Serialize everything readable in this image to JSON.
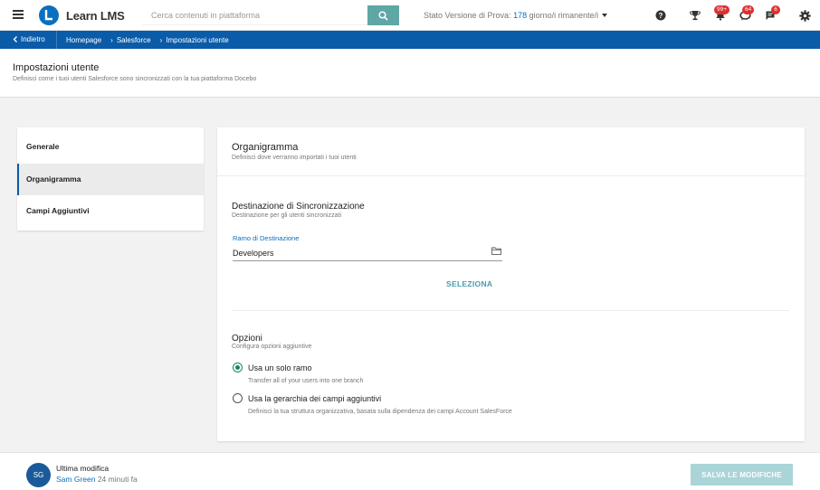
{
  "topbar": {
    "brand": "Learn LMS",
    "search_placeholder": "Cerca contenuti in piattaforma",
    "trial_prefix": "Stato Versione di Prova: ",
    "trial_days": "178",
    "trial_suffix": " giorno/i rimanente/i",
    "badges": {
      "notifications": "99+",
      "messages": "64",
      "tasks": "6"
    },
    "accent_color": "#0a5ba8"
  },
  "breadcrumb": {
    "back_label": "Indietro",
    "items": [
      "Homepage",
      "Salesforce",
      "Impostazioni utente"
    ]
  },
  "page_header": {
    "title": "Impostazioni utente",
    "subtitle": "Definisci come i tuoi utenti Salesforce sono sincronizzati con la tua piattaforma Docebo"
  },
  "sidebar": {
    "items": [
      {
        "label": "Generale",
        "active": false
      },
      {
        "label": "Organigramma",
        "active": true
      },
      {
        "label": "Campi Aggiuntivi",
        "active": false
      }
    ]
  },
  "panel": {
    "title": "Organigramma",
    "subtitle": "Definisci dove verranno importati i tuoi utenti",
    "destination": {
      "title": "Destinazione di Sincronizzazione",
      "subtitle": "Destinazione per gli utenti sincronizzati",
      "field_label": "Ramo di Destinazione",
      "field_value": "Developers",
      "select_label": "SELEZIONA"
    },
    "options": {
      "title": "Opzioni",
      "subtitle": "Configura opzioni aggiuntive",
      "radios": [
        {
          "label": "Usa un solo ramo",
          "description": "Transfer all of your users into one branch",
          "checked": true
        },
        {
          "label": "Usa la gerarchia dei campi aggiuntivi",
          "description": "Definisci la tua struttura organizzativa, basata sulla dipendenza dei campi Account SalesForce",
          "checked": false
        }
      ]
    }
  },
  "footer": {
    "avatar_initials": "SG",
    "last_modified_label": "Ultima modifica",
    "user_name": "Sam Green",
    "time_ago": " 24 minuti fa",
    "save_label": "SALVA LE MODIFICHE"
  }
}
